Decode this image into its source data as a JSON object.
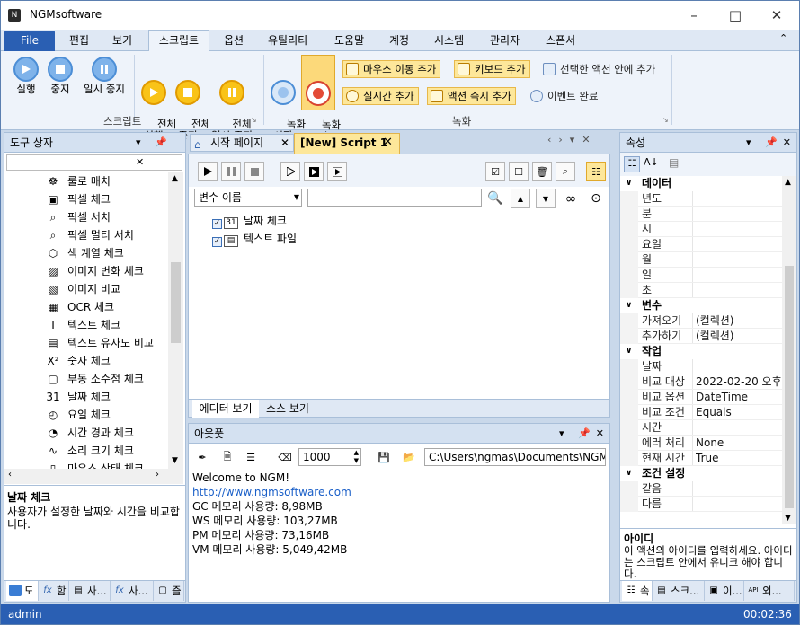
{
  "window": {
    "title": "NGMsoftware"
  },
  "menu": {
    "file": "File",
    "items": [
      "편집",
      "보기",
      "스크립트",
      "옵션",
      "유틸리티",
      "도움말",
      "계정",
      "시스템",
      "관리자",
      "스폰서"
    ]
  },
  "ribbon": {
    "script_group": "스크립트",
    "record_group": "녹화",
    "run": "실행",
    "stop": "중지",
    "pause": "일시 중지",
    "run_all": "전체\n실행",
    "stop_all": "전체\n중지",
    "pause_all": "전체\n일시 중지",
    "rec_start": "녹화\n시작",
    "rec_stop": "녹화\n중지",
    "add_mouse": "마우스 이동 추가",
    "add_keyboard": "키보드 추가",
    "add_in_action": "선택한 액션 안에 추가",
    "add_realtime": "실시간 추가",
    "add_action_now": "액션 즉시 추가",
    "event_done": "이벤트 완료"
  },
  "toolbox": {
    "title": "도구 상자",
    "items": [
      {
        "label": "룰로 매치",
        "icon": "roulette-icon"
      },
      {
        "label": "픽셀 체크",
        "icon": "camera-icon"
      },
      {
        "label": "픽셀 서치",
        "icon": "search-icon"
      },
      {
        "label": "픽셀 멀티 서치",
        "icon": "multi-search-icon"
      },
      {
        "label": "색 계열 체크",
        "icon": "cube-icon"
      },
      {
        "label": "이미지 변화 체크",
        "icon": "image-change-icon"
      },
      {
        "label": "이미지 비교",
        "icon": "image-compare-icon"
      },
      {
        "label": "OCR 체크",
        "icon": "ocr-icon"
      },
      {
        "label": "텍스트 체크",
        "icon": "text-icon"
      },
      {
        "label": "텍스트 유사도 비교",
        "icon": "text-similarity-icon"
      },
      {
        "label": "숫자 체크",
        "icon": "number-icon"
      },
      {
        "label": "부동 소수점 체크",
        "icon": "float-icon"
      },
      {
        "label": "날짜 체크",
        "icon": "calendar-icon"
      },
      {
        "label": "요일 체크",
        "icon": "weekday-icon"
      },
      {
        "label": "시간 경과 체크",
        "icon": "timer-icon"
      },
      {
        "label": "소리 크기 체크",
        "icon": "sound-icon"
      },
      {
        "label": "마우스 상태 체크",
        "icon": "mouse-icon"
      }
    ],
    "desc_title": "날짜 체크",
    "desc_text": "사용자가 설정한 날짜와 시간을 비교합니다.",
    "tabs": [
      "도",
      "함",
      "사...",
      "사...",
      "즐"
    ]
  },
  "doc_tabs": {
    "start": "시작 페이지",
    "script": "[New] Script 1"
  },
  "editor": {
    "var_select": "변수 이름",
    "items": [
      {
        "label": "날짜 체크"
      },
      {
        "label": "텍스트 파일"
      }
    ],
    "view_editor": "에디터 보기",
    "view_source": "소스 보기"
  },
  "output": {
    "title": "아웃풋",
    "number": "1000",
    "path": "C:\\Users\\ngmas\\Documents\\NGM6\\",
    "lines": [
      "Welcome to NGM!",
      "http://www.ngmsoftware.com",
      "GC 메모리 사용량: 8,98MB",
      "WS 메모리 사용량: 103,27MB",
      "PM 메모리 사용량: 73,16MB",
      "VM 메모리 사용량: 5,049,42MB"
    ]
  },
  "properties": {
    "title": "속성",
    "cats": {
      "data": "데이터",
      "var": "변수",
      "work": "작업",
      "cond": "조건 설정"
    },
    "data_rows": [
      "년도",
      "분",
      "시",
      "요일",
      "월",
      "일",
      "초"
    ],
    "var_rows": [
      {
        "name": "가져오기",
        "value": "(컬렉션)"
      },
      {
        "name": "추가하기",
        "value": "(컬렉션)"
      }
    ],
    "work_rows": [
      {
        "name": "날짜",
        "value": ""
      },
      {
        "name": "비교 대상",
        "value": "2022-02-20 오후"
      },
      {
        "name": "비교 옵션",
        "value": "DateTime"
      },
      {
        "name": "비교 조건",
        "value": "Equals"
      },
      {
        "name": "시간",
        "value": ""
      },
      {
        "name": "에러 처리",
        "value": "None"
      },
      {
        "name": "현재 시간",
        "value": "True"
      }
    ],
    "cond_rows": [
      "같음",
      "다름"
    ],
    "desc_title": "아이디",
    "desc_text": "이 액션의 아이디를 입력하세요. 아이디는 스크립트 안에서 유니크 해야 합니다.",
    "tabs": [
      "속",
      "스크...",
      "이...",
      "외..."
    ]
  },
  "status": {
    "user": "admin",
    "time": "00:02:36"
  }
}
